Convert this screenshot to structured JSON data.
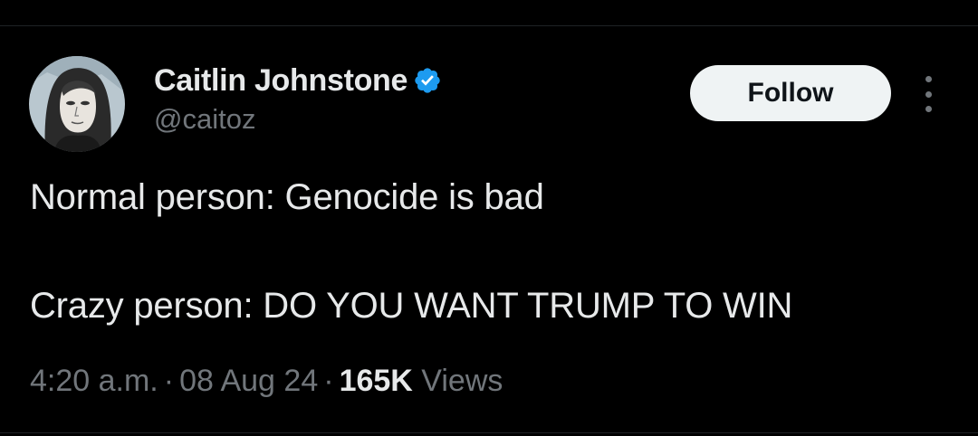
{
  "tweet": {
    "author": {
      "display_name": "Caitlin Johnstone",
      "handle": "@caitoz",
      "verified": true
    },
    "follow_label": "Follow",
    "text_lines": [
      "Normal person: Genocide is bad",
      "Crazy person: DO YOU WANT TRUMP TO WIN"
    ],
    "time": "4:20 a.m.",
    "separator": "·",
    "date": "08 Aug 24",
    "views_count": "165K",
    "views_label": "Views"
  },
  "icons": {
    "verified": "verified-badge-icon",
    "more": "more-options-icon"
  },
  "colors": {
    "background": "#000000",
    "primary_text": "#e7e9ea",
    "secondary_text": "#71767b",
    "verified_blue": "#1d9bf0",
    "follow_button_bg": "#eff3f4"
  }
}
